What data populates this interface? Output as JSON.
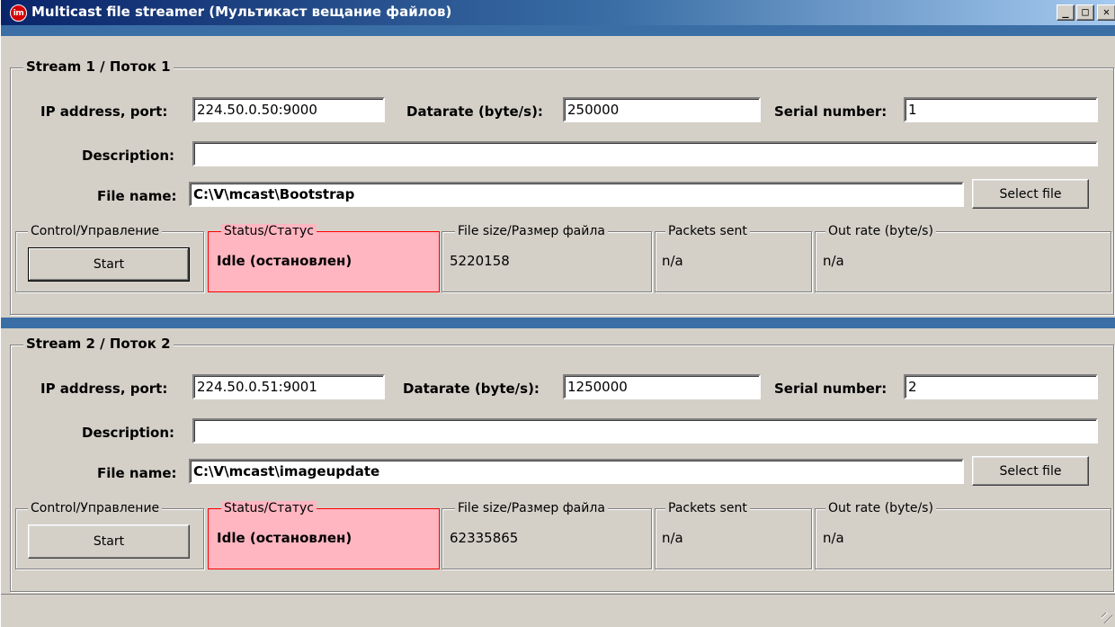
{
  "window": {
    "title": "Multicast file streamer (Мультикаст вещание файлов)",
    "icon_text": "im",
    "min_glyph": "_",
    "max_glyph": "□",
    "close_glyph": "✕"
  },
  "streams": [
    {
      "title": "Stream 1 / Поток 1",
      "ip_label": "IP address, port:",
      "ip_value": "224.50.0.50:9000",
      "datarate_label": "Datarate (byte/s):",
      "datarate_value": "250000",
      "serial_label": "Serial number:",
      "serial_value": "1",
      "description_label": "Description:",
      "description_value": "",
      "filename_label": "File name:",
      "filename_value": "C:\\V\\mcast\\Bootstrap",
      "select_file_label": "Select file",
      "control_legend": "Control/Управление",
      "start_label": "Start",
      "status_legend": "Status/Статус",
      "status_value": "Idle (остановлен)",
      "filesize_legend": "File size/Размер файла",
      "filesize_value": "5220158",
      "packets_legend": "Packets sent",
      "packets_value": "n/a",
      "outrate_legend": "Out rate (byte/s)",
      "outrate_value": "n/a"
    },
    {
      "title": "Stream 2 / Поток 2",
      "ip_label": "IP address, port:",
      "ip_value": "224.50.0.51:9001",
      "datarate_label": "Datarate (byte/s):",
      "datarate_value": "1250000",
      "serial_label": "Serial number:",
      "serial_value": "2",
      "description_label": "Description:",
      "description_value": "",
      "filename_label": "File name:",
      "filename_value": "C:\\V\\mcast\\imageupdate",
      "select_file_label": "Select file",
      "control_legend": "Control/Управление",
      "start_label": "Start",
      "status_legend": "Status/Статус",
      "status_value": "Idle (остановлен)",
      "filesize_legend": "File size/Размер файла",
      "filesize_value": "62335865",
      "packets_legend": "Packets sent",
      "packets_value": "n/a",
      "outrate_legend": "Out rate (byte/s)",
      "outrate_value": "n/a"
    }
  ],
  "colors": {
    "status_fill": "#ffb6c1",
    "status_border": "#ff0000",
    "splitter": "#3a6ea5"
  }
}
